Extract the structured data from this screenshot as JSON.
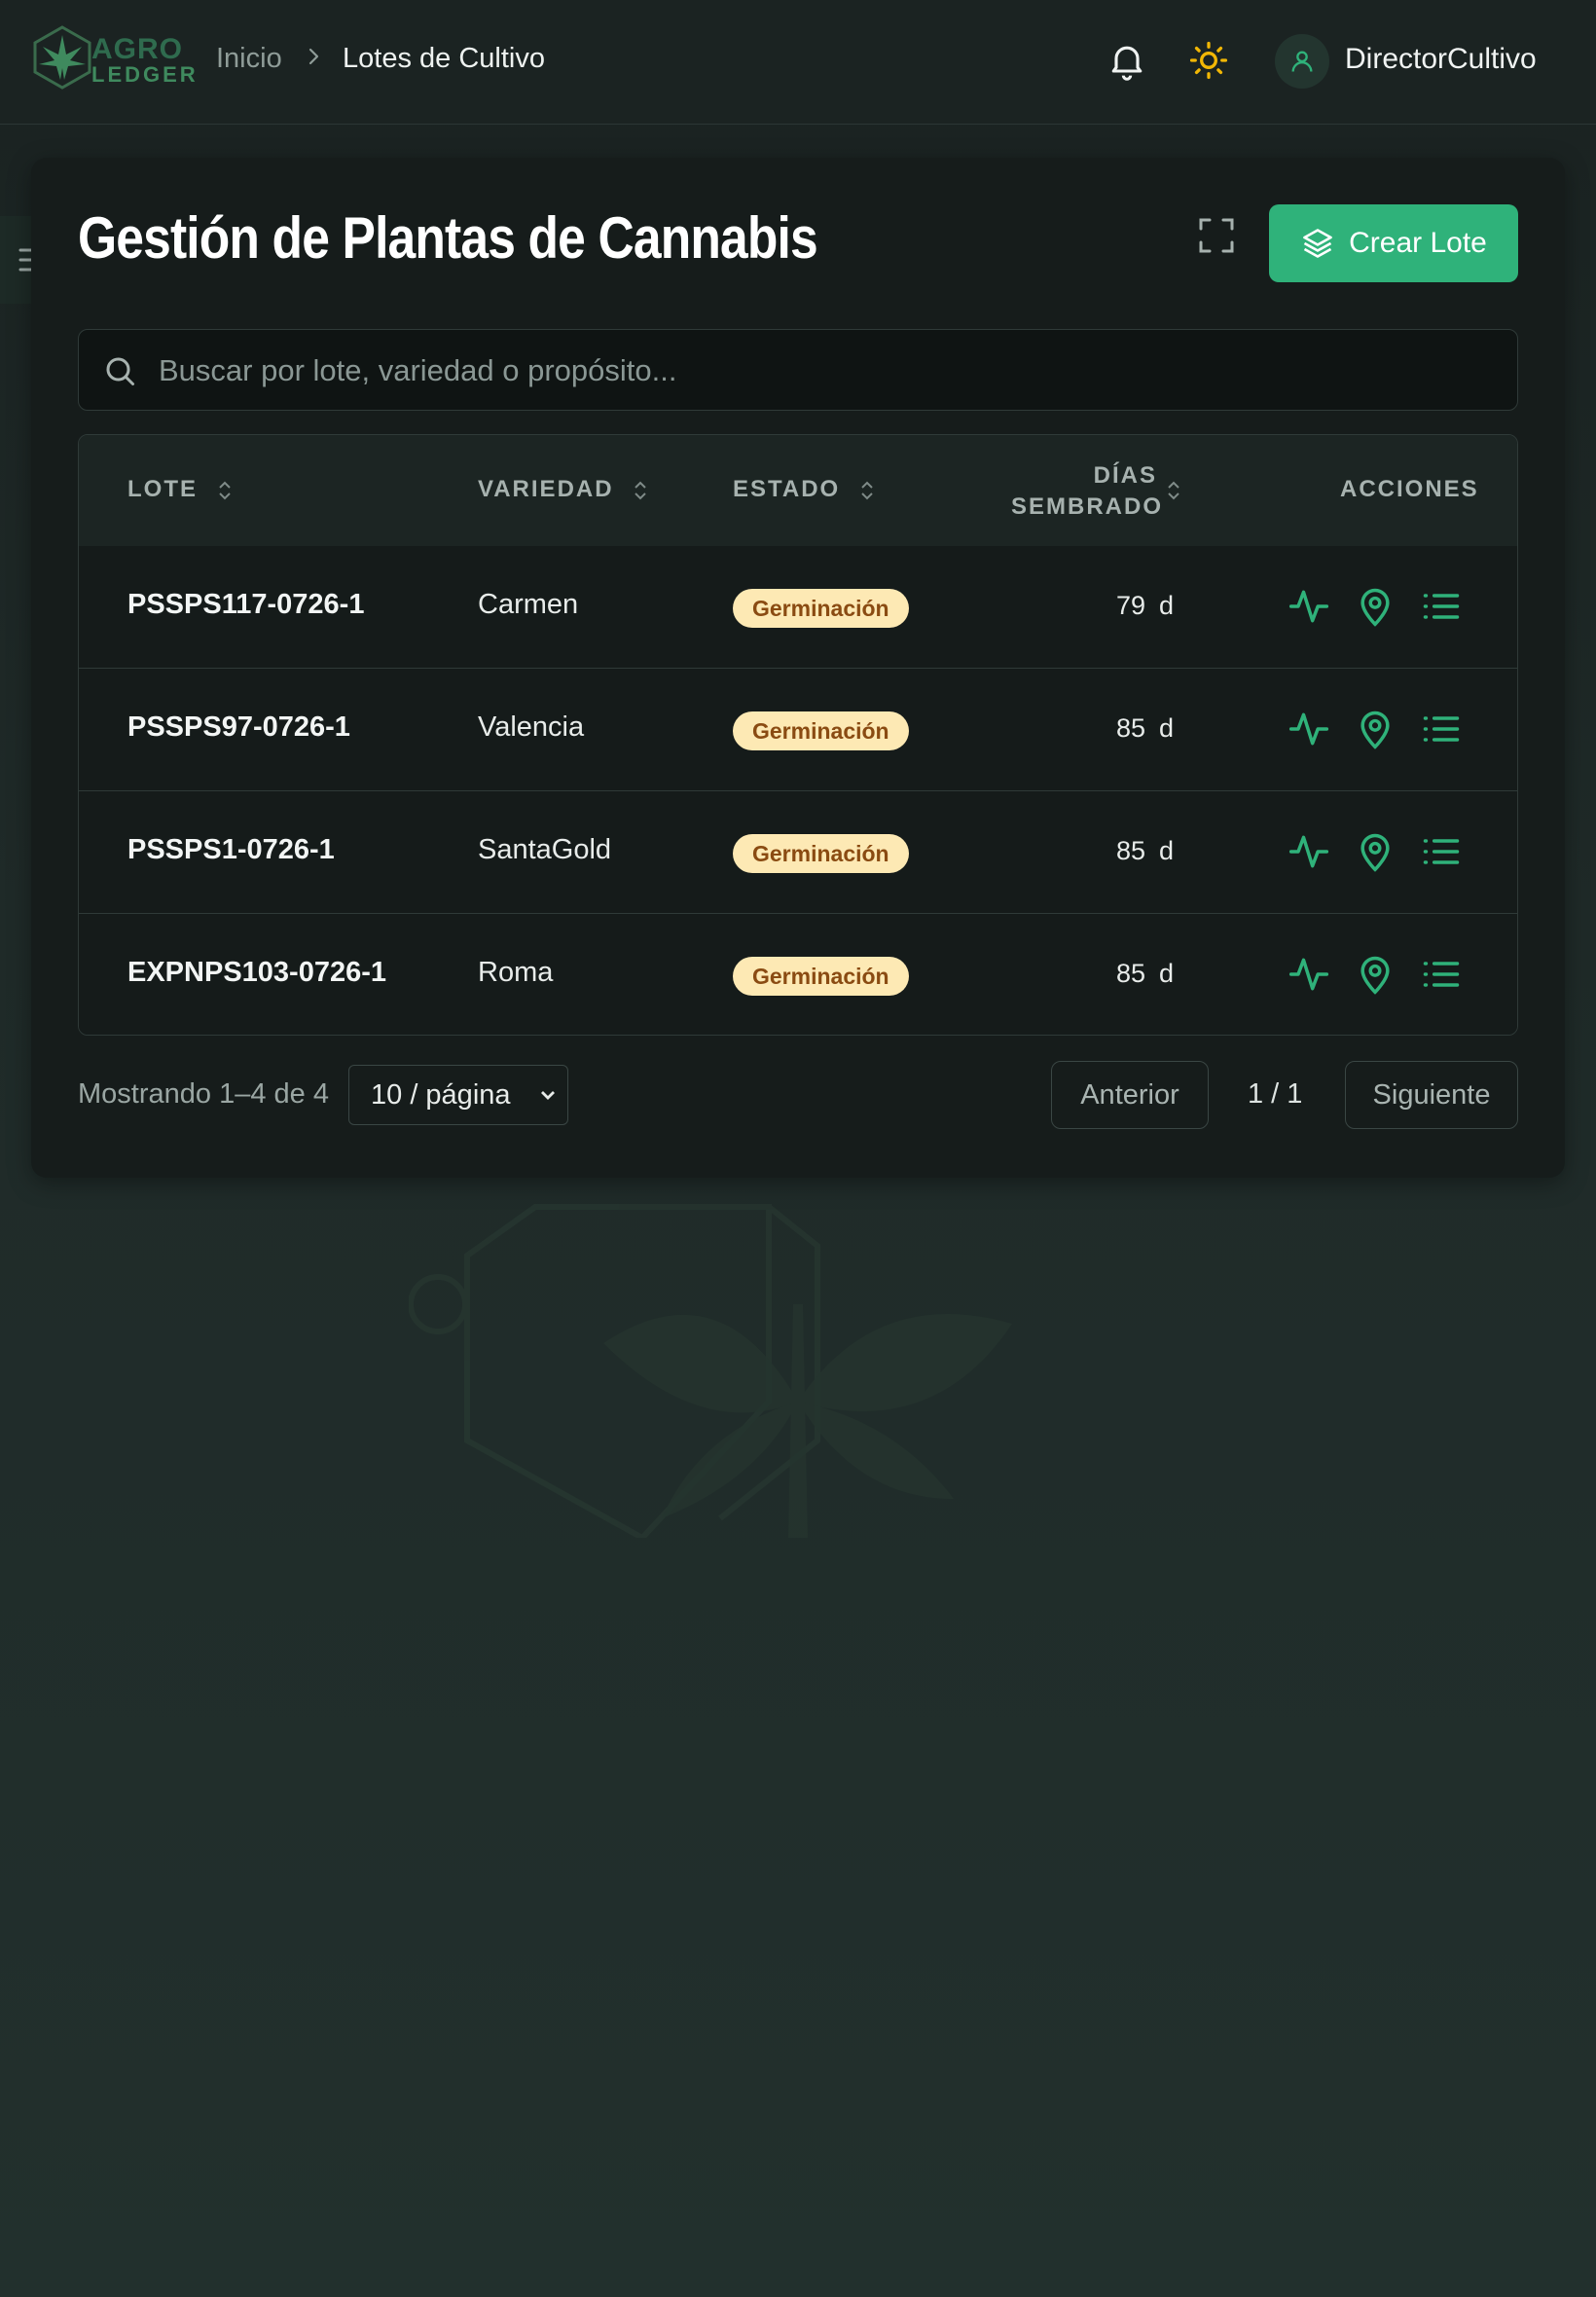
{
  "header": {
    "logo_line1": "AGRO",
    "logo_line2": "LEDGER",
    "breadcrumb_home": "Inicio",
    "breadcrumb_current": "Lotes de Cultivo",
    "username": "DirectorCultivo"
  },
  "page": {
    "title": "Gestión de Plantas de Cannabis",
    "create_button_label": "Crear Lote",
    "search_placeholder": "Buscar por lote, variedad o propósito..."
  },
  "table": {
    "columns": {
      "lote": "LOTE",
      "variedad": "VARIEDAD",
      "estado": "ESTADO",
      "dias_line1": "DÍAS",
      "dias_line2": "SEMBRADO",
      "acciones": "ACCIONES"
    },
    "rows": [
      {
        "lote": "PSSPS117-0726-1",
        "variedad": "Carmen",
        "estado": "Germinación",
        "dias": "79",
        "unit": "d"
      },
      {
        "lote": "PSSPS97-0726-1",
        "variedad": "Valencia",
        "estado": "Germinación",
        "dias": "85",
        "unit": "d"
      },
      {
        "lote": "PSSPS1-0726-1",
        "variedad": "SantaGold",
        "estado": "Germinación",
        "dias": "85",
        "unit": "d"
      },
      {
        "lote": "EXPNPS103-0726-1",
        "variedad": "Roma",
        "estado": "Germinación",
        "dias": "85",
        "unit": "d"
      }
    ]
  },
  "footer": {
    "showing": "Mostrando 1–4 de 4",
    "page_size": "10 / página",
    "prev_label": "Anterior",
    "page_indicator": "1 / 1",
    "next_label": "Siguiente"
  },
  "colors": {
    "accent": "#2fb27a",
    "badge_bg": "#fde9b4",
    "badge_text": "#8a4b12",
    "sun": "#f2b705"
  },
  "icons": [
    "bell-icon",
    "sun-icon",
    "user-icon",
    "menu-icon",
    "expand-icon",
    "layers-icon",
    "search-icon",
    "sort-icon",
    "activity-icon",
    "map-pin-icon",
    "list-icon",
    "chevron-right-icon"
  ]
}
